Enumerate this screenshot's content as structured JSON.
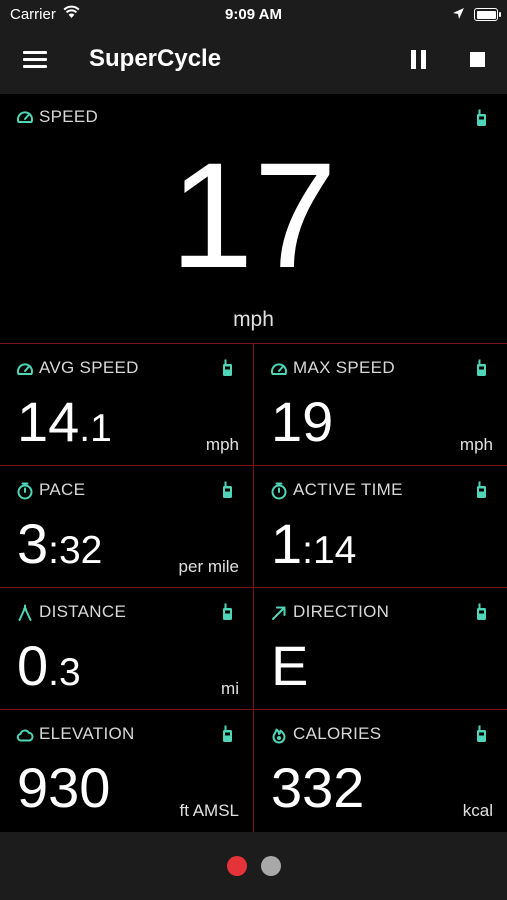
{
  "status_bar": {
    "carrier": "Carrier",
    "time": "9:09 AM"
  },
  "navbar": {
    "title": "SuperCycle"
  },
  "colors": {
    "accent": "#4fd6b8",
    "divider": "#7a1515",
    "active_dot": "#e5333a",
    "inactive_dot": "#a8a8a8"
  },
  "speed": {
    "label": "SPEED",
    "value": "17",
    "unit": "mph",
    "icon": "speedometer-icon"
  },
  "tiles": [
    {
      "label": "AVG SPEED",
      "whole": "14",
      "frac": ".1",
      "unit": "mph",
      "icon": "speedometer-icon"
    },
    {
      "label": "MAX SPEED",
      "whole": "19",
      "frac": "",
      "unit": "mph",
      "icon": "speedometer-icon"
    },
    {
      "label": "PACE",
      "whole": "3",
      "frac": ":32",
      "unit": "per mile",
      "icon": "stopwatch-icon"
    },
    {
      "label": "ACTIVE TIME",
      "whole": "1",
      "frac": ":14",
      "unit": "",
      "icon": "stopwatch-icon"
    },
    {
      "label": "DISTANCE",
      "whole": "0",
      "frac": ".3",
      "unit": "mi",
      "icon": "compass-divider-icon"
    },
    {
      "label": "DIRECTION",
      "whole": "E",
      "frac": "",
      "unit": "",
      "icon": "arrow-up-right-icon"
    },
    {
      "label": "ELEVATION",
      "whole": "930",
      "frac": "",
      "unit": "ft AMSL",
      "icon": "cloud-icon"
    },
    {
      "label": "CALORIES",
      "whole": "332",
      "frac": "",
      "unit": "kcal",
      "icon": "flame-icon"
    }
  ],
  "pager": {
    "pages": 2,
    "active": 1
  }
}
